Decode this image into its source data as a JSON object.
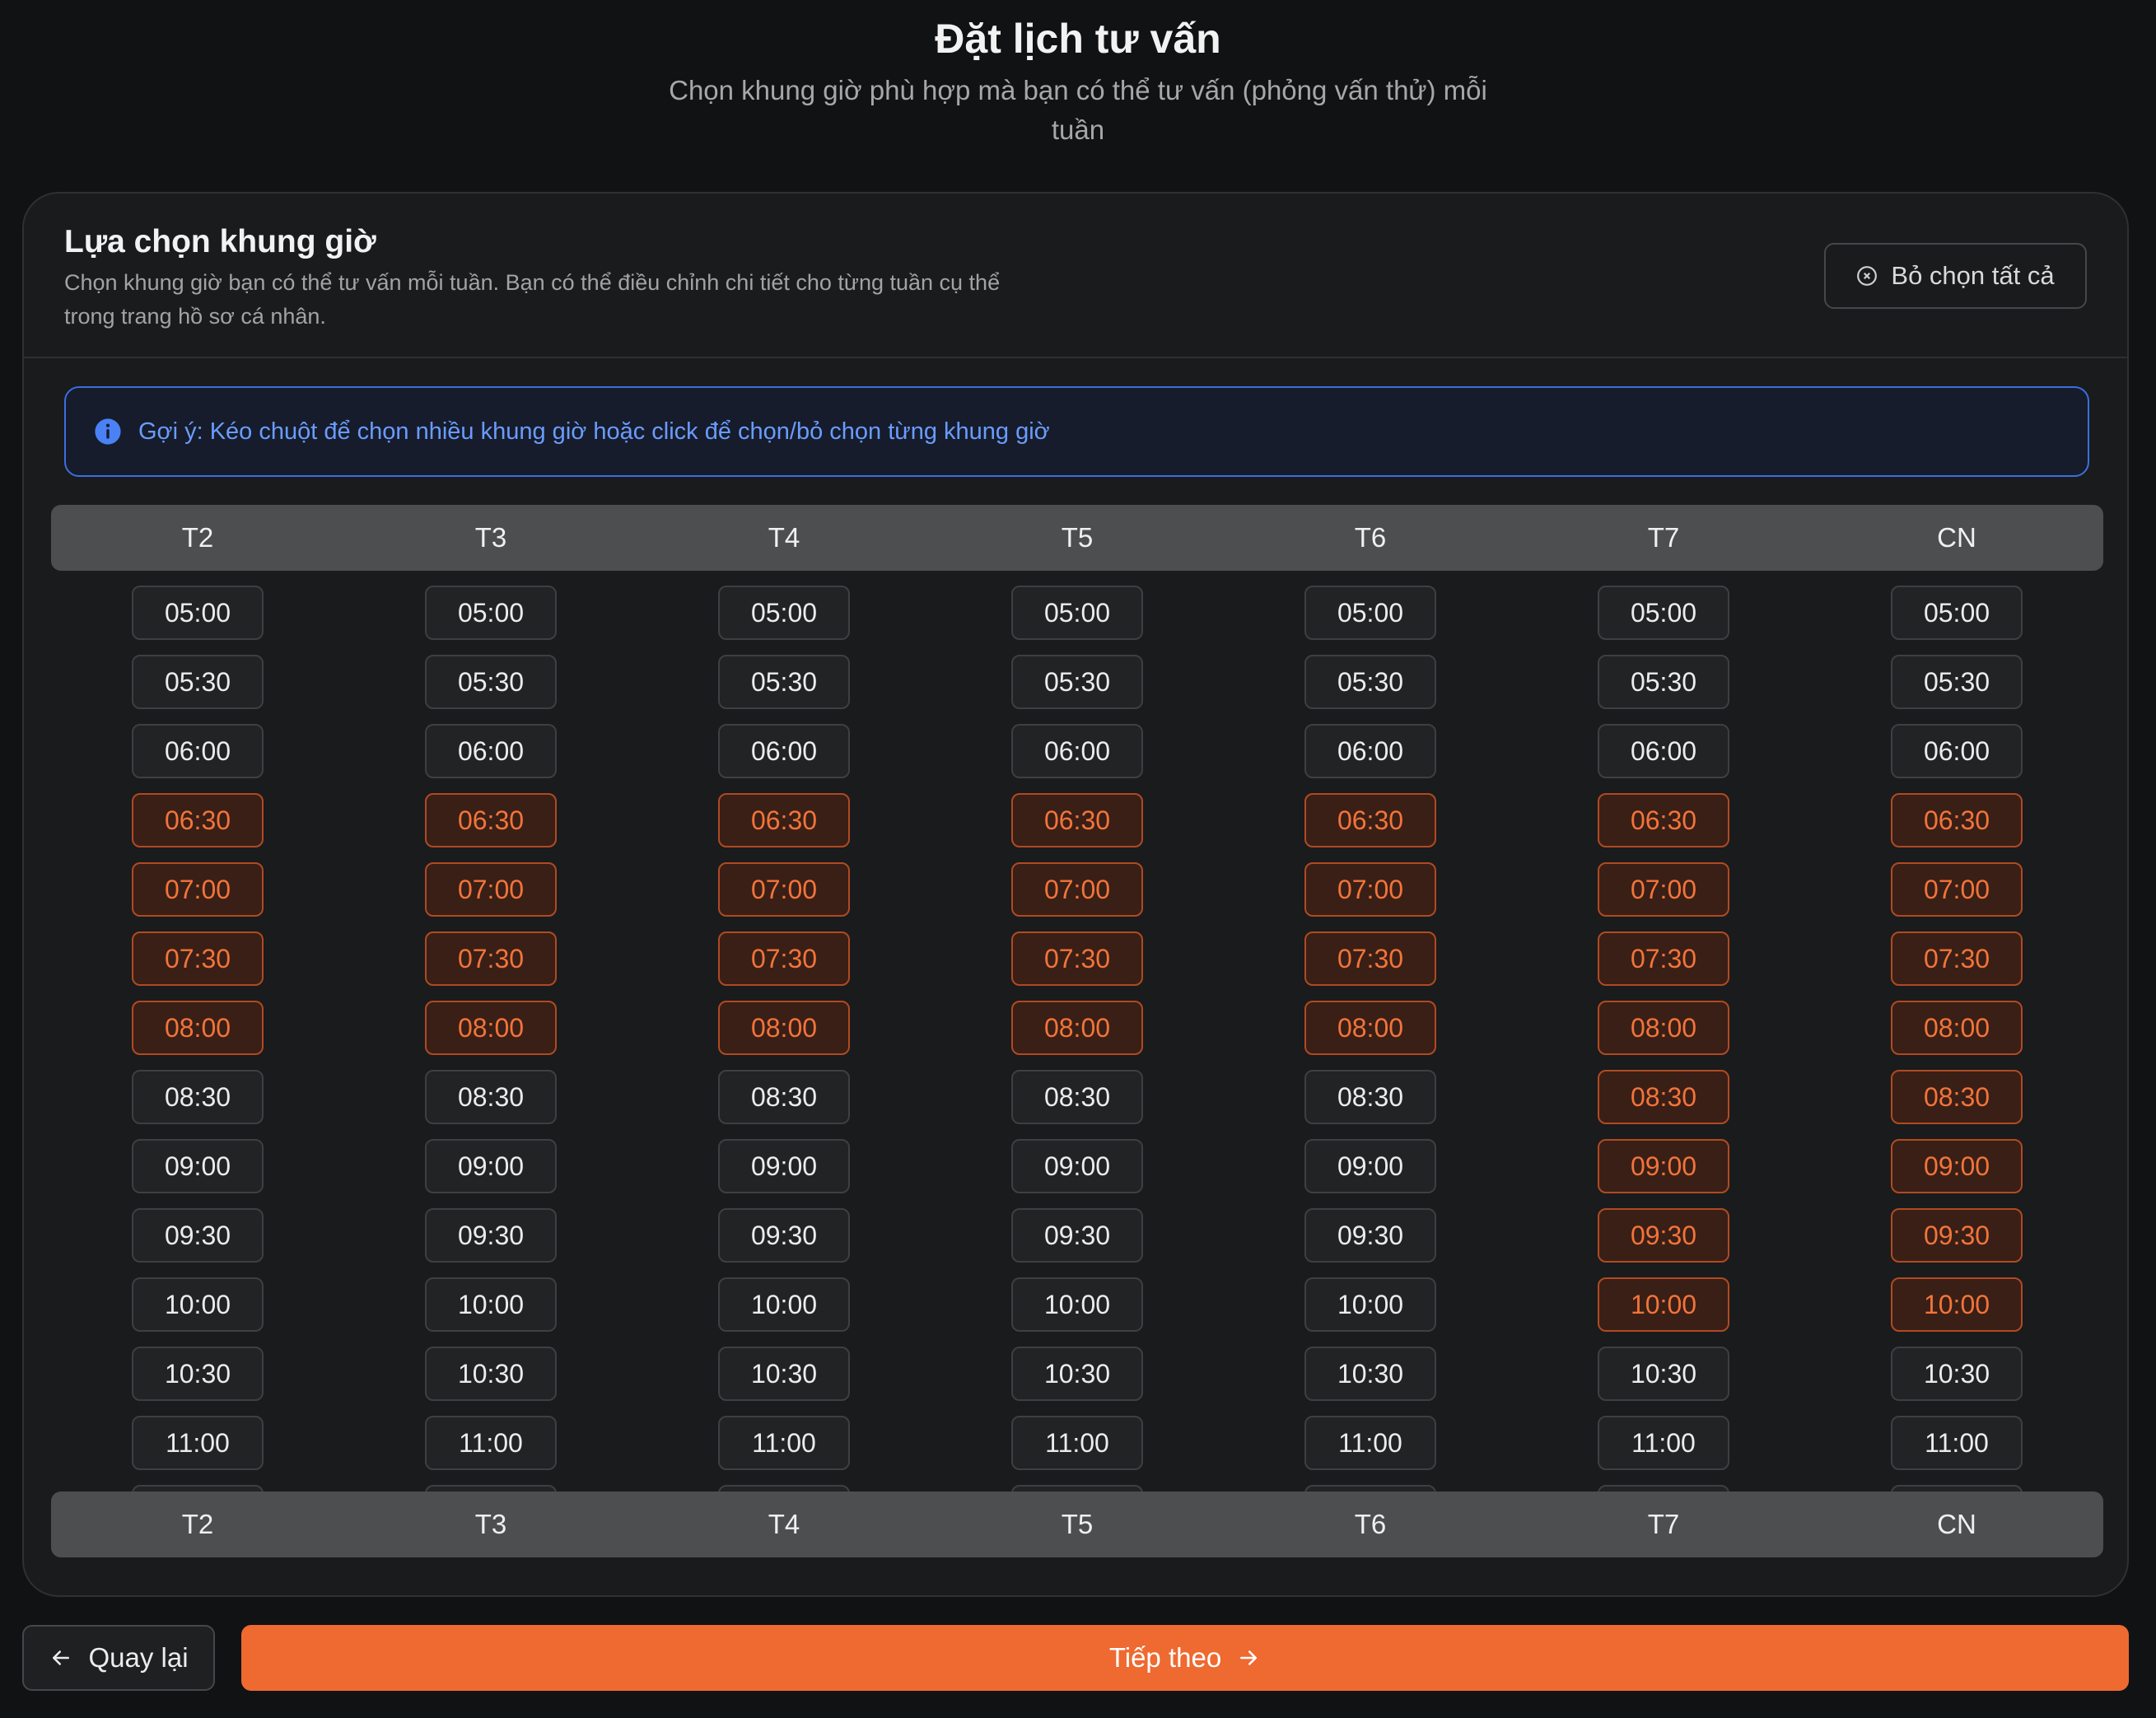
{
  "page": {
    "title": "Đặt lịch tư vấn",
    "subtitle": "Chọn khung giờ phù hợp mà bạn có thể tư vấn (phỏng vấn thử) mỗi tuần"
  },
  "card": {
    "title": "Lựa chọn khung giờ",
    "description": "Chọn khung giờ bạn có thể tư vấn mỗi tuần. Bạn có thể điều chỉnh chi tiết cho từng tuần cụ thể trong trang hồ sơ cá nhân.",
    "clear_all_label": "Bỏ chọn tất cả",
    "hint": "Gợi ý: Kéo chuột để chọn nhiều khung giờ hoặc click để chọn/bỏ chọn từng khung giờ"
  },
  "days": [
    "T2",
    "T3",
    "T4",
    "T5",
    "T6",
    "T7",
    "CN"
  ],
  "times": [
    "05:00",
    "05:30",
    "06:00",
    "06:30",
    "07:00",
    "07:30",
    "08:00",
    "08:30",
    "09:00",
    "09:30",
    "10:00",
    "10:30",
    "11:00"
  ],
  "selected": {
    "T2": [
      "06:30",
      "07:00",
      "07:30",
      "08:00"
    ],
    "T3": [
      "06:30",
      "07:00",
      "07:30",
      "08:00"
    ],
    "T4": [
      "06:30",
      "07:00",
      "07:30",
      "08:00"
    ],
    "T5": [
      "06:30",
      "07:00",
      "07:30",
      "08:00"
    ],
    "T6": [
      "06:30",
      "07:00",
      "07:30",
      "08:00"
    ],
    "T7": [
      "06:30",
      "07:00",
      "07:30",
      "08:00",
      "08:30",
      "09:00",
      "09:30",
      "10:00"
    ],
    "CN": [
      "06:30",
      "07:00",
      "07:30",
      "08:00",
      "08:30",
      "09:00",
      "09:30",
      "10:00"
    ]
  },
  "footer": {
    "back_label": "Quay lại",
    "next_label": "Tiếp theo"
  },
  "colors": {
    "accent": "#ee6a30",
    "selected_text": "#f2743a",
    "hint_border": "#3b6fe0"
  },
  "icons": {
    "clear": "x-circle-icon",
    "hint": "info-icon",
    "back": "arrow-left-icon",
    "next": "arrow-right-icon"
  }
}
